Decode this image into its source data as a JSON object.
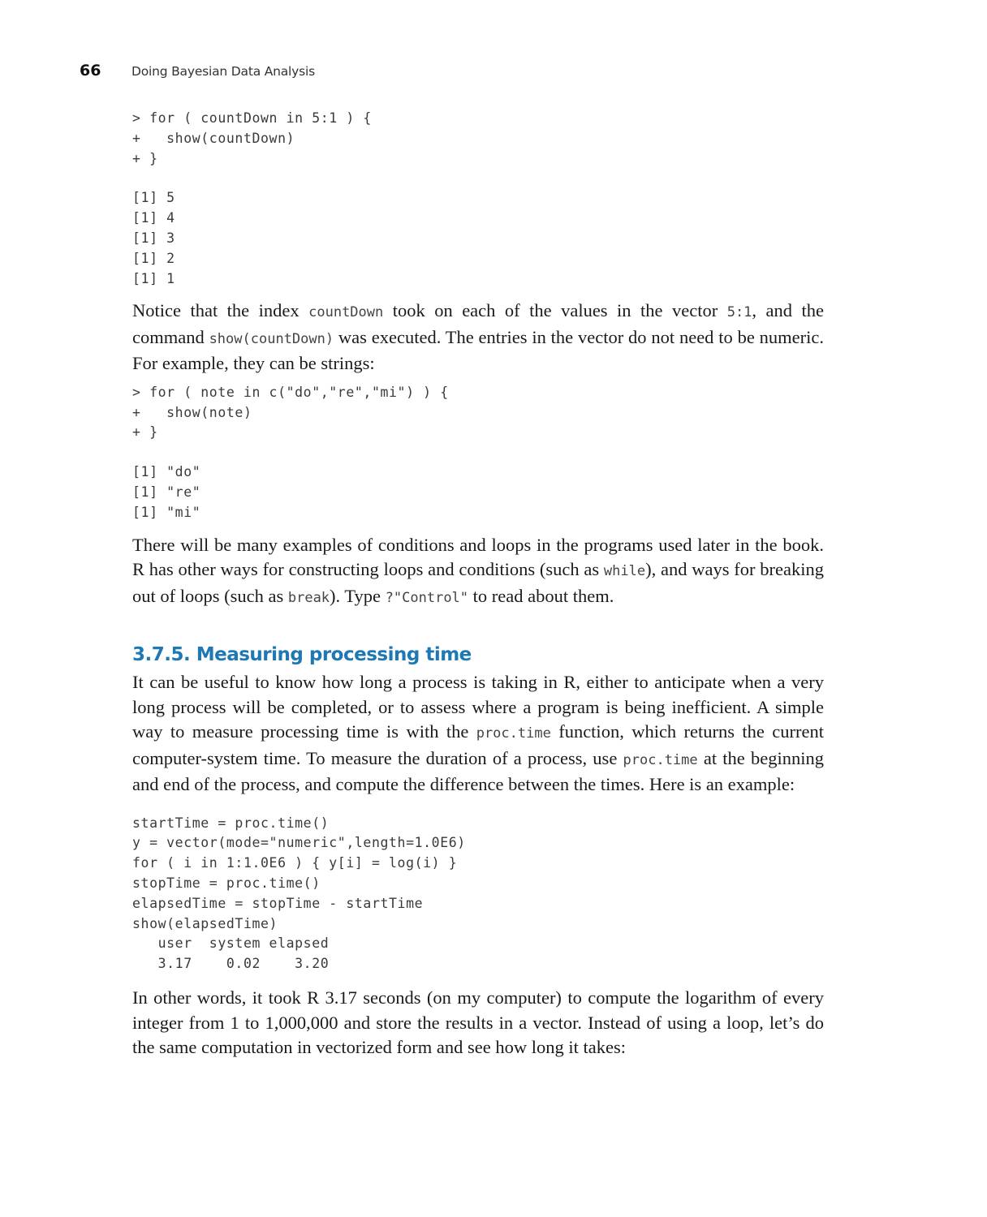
{
  "header": {
    "page_number": "66",
    "running_title": "Doing Bayesian Data Analysis"
  },
  "code_block_1": {
    "input": [
      "> for ( countDown in 5:1 ) {",
      "+   show(countDown)",
      "+ }"
    ],
    "output": [
      "[1] 5",
      "[1] 4",
      "[1] 3",
      "[1] 2",
      "[1] 1"
    ]
  },
  "para_1": {
    "t1": "Notice that the index ",
    "c1": "countDown",
    "t2": " took on each of the values in the vector ",
    "c2": "5:1",
    "t3": ", and the command ",
    "c3": "show(countDown)",
    "t4": " was executed. The entries in the vector do not need to be numeric. For example, they can be strings:"
  },
  "code_block_2": {
    "input": [
      "> for ( note in c(\"do\",\"re\",\"mi\") ) {",
      "+   show(note)",
      "+ }"
    ],
    "output": [
      "[1] \"do\"",
      "[1] \"re\"",
      "[1] \"mi\""
    ]
  },
  "para_2": {
    "t1": "There will be many examples of conditions and loops in the programs used later in the book. R has other ways for constructing loops and conditions (such as ",
    "c1": "while",
    "t2": "), and ways for breaking out of loops (such as ",
    "c2": "break",
    "t3": "). Type ",
    "c3": "?\"Control\"",
    "t4": " to read about them."
  },
  "section": {
    "heading": "3.7.5.  Measuring processing time",
    "color": "#1e78b4"
  },
  "para_3": {
    "t1": "It can be useful to know how long a process is taking in R, either to anticipate when a very long process will be completed, or to assess where a program is being inefficient. A simple way to measure processing time is with the ",
    "c1": "proc.time",
    "t2": " function, which returns the current computer-system time. To measure the duration of a process, use ",
    "c2": "proc.time",
    "t3": " at the beginning and end of the process, and compute the difference between the times. Here is an example:"
  },
  "code_block_3": {
    "lines": [
      "startTime = proc.time()",
      "y = vector(mode=\"numeric\",length=1.0E6)",
      "for ( i in 1:1.0E6 ) { y[i] = log(i) }",
      "stopTime = proc.time()",
      "elapsedTime = stopTime - startTime",
      "show(elapsedTime)",
      "   user  system elapsed",
      "   3.17    0.02    3.20"
    ]
  },
  "para_4": {
    "text": "In other words, it took R 3.17 seconds (on my computer) to compute the logarithm of every integer from 1 to 1,000,000 and store the results in a vector. Instead of using a loop, let’s do the same computation in vectorized form and see how long it takes:"
  }
}
